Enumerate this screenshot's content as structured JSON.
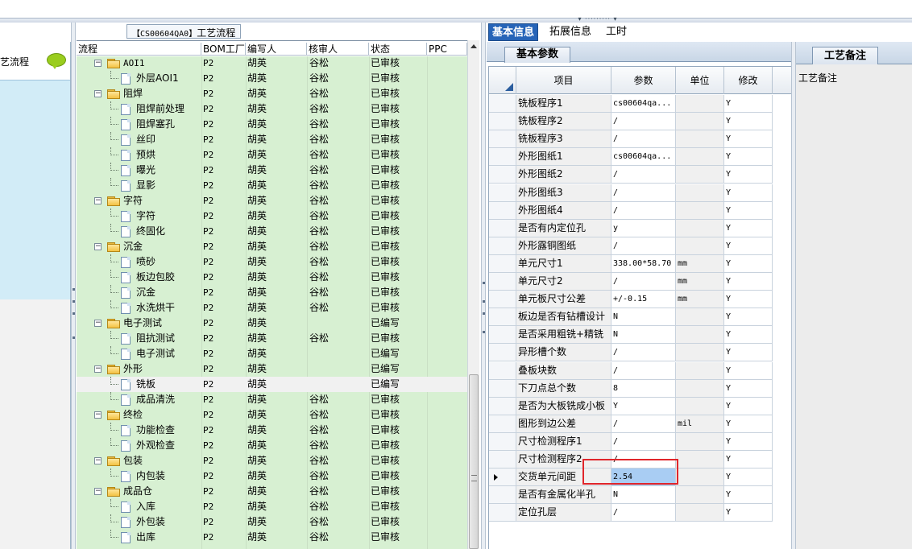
{
  "left_panel": {
    "title": "艺流程",
    "icon": "speech-bubble-icon"
  },
  "tree_caption": {
    "code": "【CS00604QA0】",
    "text": "工艺流程"
  },
  "tree_columns": [
    "流程",
    "BOM工厂",
    "编写人",
    "核审人",
    "状态",
    "PPC"
  ],
  "tree_rows": [
    {
      "level": 0,
      "type": "folder",
      "name": "AOI1",
      "bom": "P2",
      "writer": "胡英",
      "reviewer": "谷松",
      "status": "已审核"
    },
    {
      "level": 1,
      "type": "doc",
      "name": "外层AOI1",
      "bom": "P2",
      "writer": "胡英",
      "reviewer": "谷松",
      "status": "已审核"
    },
    {
      "level": 0,
      "type": "folder",
      "name": "阻焊",
      "bom": "P2",
      "writer": "胡英",
      "reviewer": "谷松",
      "status": "已审核"
    },
    {
      "level": 1,
      "type": "doc",
      "name": "阻焊前处理",
      "bom": "P2",
      "writer": "胡英",
      "reviewer": "谷松",
      "status": "已审核"
    },
    {
      "level": 1,
      "type": "doc",
      "name": "阻焊塞孔",
      "bom": "P2",
      "writer": "胡英",
      "reviewer": "谷松",
      "status": "已审核"
    },
    {
      "level": 1,
      "type": "doc",
      "name": "丝印",
      "bom": "P2",
      "writer": "胡英",
      "reviewer": "谷松",
      "status": "已审核"
    },
    {
      "level": 1,
      "type": "doc",
      "name": "预烘",
      "bom": "P2",
      "writer": "胡英",
      "reviewer": "谷松",
      "status": "已审核"
    },
    {
      "level": 1,
      "type": "doc",
      "name": "曝光",
      "bom": "P2",
      "writer": "胡英",
      "reviewer": "谷松",
      "status": "已审核"
    },
    {
      "level": 1,
      "type": "doc",
      "name": "显影",
      "bom": "P2",
      "writer": "胡英",
      "reviewer": "谷松",
      "status": "已审核"
    },
    {
      "level": 0,
      "type": "folder",
      "name": "字符",
      "bom": "P2",
      "writer": "胡英",
      "reviewer": "谷松",
      "status": "已审核"
    },
    {
      "level": 1,
      "type": "doc",
      "name": "字符",
      "bom": "P2",
      "writer": "胡英",
      "reviewer": "谷松",
      "status": "已审核"
    },
    {
      "level": 1,
      "type": "doc",
      "name": "终固化",
      "bom": "P2",
      "writer": "胡英",
      "reviewer": "谷松",
      "status": "已审核"
    },
    {
      "level": 0,
      "type": "folder",
      "name": "沉金",
      "bom": "P2",
      "writer": "胡英",
      "reviewer": "谷松",
      "status": "已审核"
    },
    {
      "level": 1,
      "type": "doc",
      "name": "喷砂",
      "bom": "P2",
      "writer": "胡英",
      "reviewer": "谷松",
      "status": "已审核"
    },
    {
      "level": 1,
      "type": "doc",
      "name": "板边包胶",
      "bom": "P2",
      "writer": "胡英",
      "reviewer": "谷松",
      "status": "已审核"
    },
    {
      "level": 1,
      "type": "doc",
      "name": "沉金",
      "bom": "P2",
      "writer": "胡英",
      "reviewer": "谷松",
      "status": "已审核"
    },
    {
      "level": 1,
      "type": "doc",
      "name": "水洗烘干",
      "bom": "P2",
      "writer": "胡英",
      "reviewer": "谷松",
      "status": "已审核"
    },
    {
      "level": 0,
      "type": "folder",
      "name": "电子测试",
      "bom": "P2",
      "writer": "胡英",
      "reviewer": "",
      "status": "已编写"
    },
    {
      "level": 1,
      "type": "doc",
      "name": "阻抗测试",
      "bom": "P2",
      "writer": "胡英",
      "reviewer": "谷松",
      "status": "已审核"
    },
    {
      "level": 1,
      "type": "doc",
      "name": "电子测试",
      "bom": "P2",
      "writer": "胡英",
      "reviewer": "",
      "status": "已编写"
    },
    {
      "level": 0,
      "type": "folder",
      "name": "外形",
      "bom": "P2",
      "writer": "胡英",
      "reviewer": "",
      "status": "已编写"
    },
    {
      "level": 1,
      "type": "doc",
      "name": "铣板",
      "bom": "P2",
      "writer": "胡英",
      "reviewer": "",
      "status": "已编写",
      "selected": true
    },
    {
      "level": 1,
      "type": "doc",
      "name": "成品清洗",
      "bom": "P2",
      "writer": "胡英",
      "reviewer": "谷松",
      "status": "已审核"
    },
    {
      "level": 0,
      "type": "folder",
      "name": "终检",
      "bom": "P2",
      "writer": "胡英",
      "reviewer": "谷松",
      "status": "已审核"
    },
    {
      "level": 1,
      "type": "doc",
      "name": "功能检查",
      "bom": "P2",
      "writer": "胡英",
      "reviewer": "谷松",
      "status": "已审核"
    },
    {
      "level": 1,
      "type": "doc",
      "name": "外观检查",
      "bom": "P2",
      "writer": "胡英",
      "reviewer": "谷松",
      "status": "已审核"
    },
    {
      "level": 0,
      "type": "folder",
      "name": "包装",
      "bom": "P2",
      "writer": "胡英",
      "reviewer": "谷松",
      "status": "已审核"
    },
    {
      "level": 1,
      "type": "doc",
      "name": "内包装",
      "bom": "P2",
      "writer": "胡英",
      "reviewer": "谷松",
      "status": "已审核"
    },
    {
      "level": 0,
      "type": "folder",
      "name": "成品仓",
      "bom": "P2",
      "writer": "胡英",
      "reviewer": "谷松",
      "status": "已审核"
    },
    {
      "level": 1,
      "type": "doc",
      "name": "入库",
      "bom": "P2",
      "writer": "胡英",
      "reviewer": "谷松",
      "status": "已审核"
    },
    {
      "level": 1,
      "type": "doc",
      "name": "外包装",
      "bom": "P2",
      "writer": "胡英",
      "reviewer": "谷松",
      "status": "已审核"
    },
    {
      "level": 1,
      "type": "doc",
      "name": "出库",
      "bom": "P2",
      "writer": "胡英",
      "reviewer": "谷松",
      "status": "已审核"
    }
  ],
  "tabs": [
    "基本信息",
    "拓展信息",
    "工时"
  ],
  "sub_tab": "基本参数",
  "grid_columns": [
    "项目",
    "参数",
    "单位",
    "修改"
  ],
  "grid_rows": [
    {
      "label": "铣板程序1",
      "param": "cs00604qa...",
      "unit": "",
      "mod": "Y"
    },
    {
      "label": "铣板程序2",
      "param": "/",
      "unit": "",
      "mod": "Y"
    },
    {
      "label": "铣板程序3",
      "param": "/",
      "unit": "",
      "mod": "Y"
    },
    {
      "label": "外形图纸1",
      "param": "cs00604qa...",
      "unit": "",
      "mod": "Y"
    },
    {
      "label": "外形图纸2",
      "param": "/",
      "unit": "",
      "mod": "Y"
    },
    {
      "label": "外形图纸3",
      "param": "/",
      "unit": "",
      "mod": "Y"
    },
    {
      "label": "外形图纸4",
      "param": "/",
      "unit": "",
      "mod": "Y"
    },
    {
      "label": "是否有内定位孔",
      "param": "y",
      "unit": "",
      "mod": "Y"
    },
    {
      "label": "外形露铜图纸",
      "param": "/",
      "unit": "",
      "mod": "Y"
    },
    {
      "label": "单元尺寸1",
      "param": "338.00*58.70",
      "unit": "mm",
      "mod": "Y"
    },
    {
      "label": "单元尺寸2",
      "param": "/",
      "unit": "mm",
      "mod": "Y"
    },
    {
      "label": "单元板尺寸公差",
      "param": "+/-0.15",
      "unit": "mm",
      "mod": "Y"
    },
    {
      "label": "板边是否有钻槽设计",
      "param": "N",
      "unit": "",
      "mod": "Y"
    },
    {
      "label": "是否采用粗铣+精铣",
      "param": "N",
      "unit": "",
      "mod": "Y"
    },
    {
      "label": "异形槽个数",
      "param": "/",
      "unit": "",
      "mod": "Y"
    },
    {
      "label": "叠板块数",
      "param": "/",
      "unit": "",
      "mod": "Y"
    },
    {
      "label": "下刀点总个数",
      "param": "8",
      "unit": "",
      "mod": "Y"
    },
    {
      "label": "是否为大板铣成小板",
      "param": "Y",
      "unit": "",
      "mod": "Y"
    },
    {
      "label": "图形到边公差",
      "param": "/",
      "unit": "mil",
      "mod": "Y"
    },
    {
      "label": "尺寸检测程序1",
      "param": "/",
      "unit": "",
      "mod": "Y"
    },
    {
      "label": "尺寸检测程序2",
      "param": "/",
      "unit": "",
      "mod": "Y"
    },
    {
      "label": "交货单元间距",
      "param": "2.54",
      "unit": "",
      "mod": "Y",
      "current": true
    },
    {
      "label": "是否有金属化半孔",
      "param": "N",
      "unit": "",
      "mod": "Y"
    },
    {
      "label": "定位孔层",
      "param": "/",
      "unit": "",
      "mod": "Y"
    }
  ],
  "notes": {
    "tab": "工艺备注",
    "label": "工艺备注"
  }
}
